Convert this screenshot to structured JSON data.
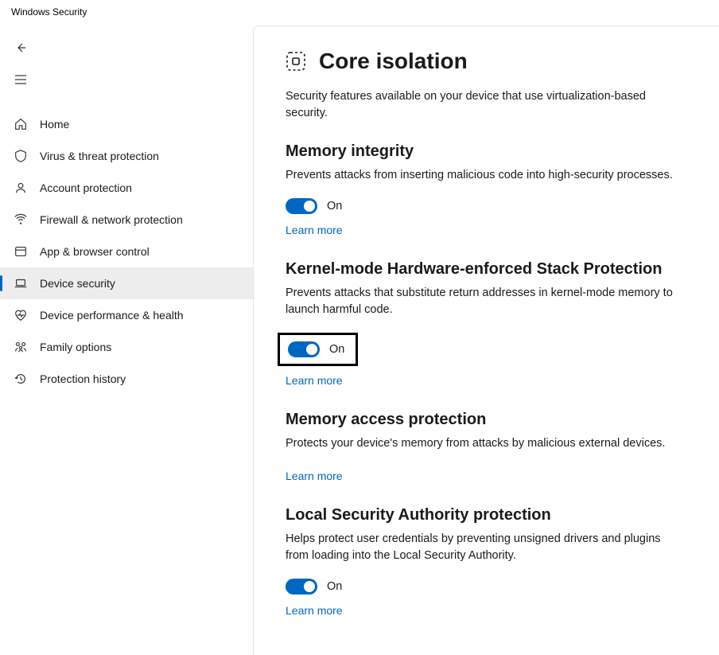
{
  "app_title": "Windows Security",
  "sidebar": {
    "items": [
      {
        "label": "Home",
        "icon": "home-icon",
        "active": false
      },
      {
        "label": "Virus & threat protection",
        "icon": "shield-icon",
        "active": false
      },
      {
        "label": "Account protection",
        "icon": "person-icon",
        "active": false
      },
      {
        "label": "Firewall & network protection",
        "icon": "network-icon",
        "active": false
      },
      {
        "label": "App & browser control",
        "icon": "window-icon",
        "active": false
      },
      {
        "label": "Device security",
        "icon": "laptop-icon",
        "active": true
      },
      {
        "label": "Device performance & health",
        "icon": "heart-icon",
        "active": false
      },
      {
        "label": "Family options",
        "icon": "family-icon",
        "active": false
      },
      {
        "label": "Protection history",
        "icon": "history-icon",
        "active": false
      }
    ]
  },
  "page": {
    "title": "Core isolation",
    "subtitle": "Security features available on your device that use virtualization-based security."
  },
  "sections": {
    "memory_integrity": {
      "title": "Memory integrity",
      "desc": "Prevents attacks from inserting malicious code into high-security processes.",
      "toggle_state": "On",
      "learn_more": "Learn more"
    },
    "kernel_stack": {
      "title": "Kernel-mode Hardware-enforced Stack Protection",
      "desc": "Prevents attacks that substitute return addresses in kernel-mode memory to launch harmful code.",
      "toggle_state": "On",
      "learn_more": "Learn more"
    },
    "memory_access": {
      "title": "Memory access protection",
      "desc": "Protects your device's memory from attacks by malicious external devices.",
      "learn_more": "Learn more"
    },
    "lsa": {
      "title": "Local Security Authority protection",
      "desc": "Helps protect user credentials by preventing unsigned drivers and plugins from loading into the Local Security Authority.",
      "toggle_state": "On",
      "learn_more": "Learn more"
    }
  }
}
